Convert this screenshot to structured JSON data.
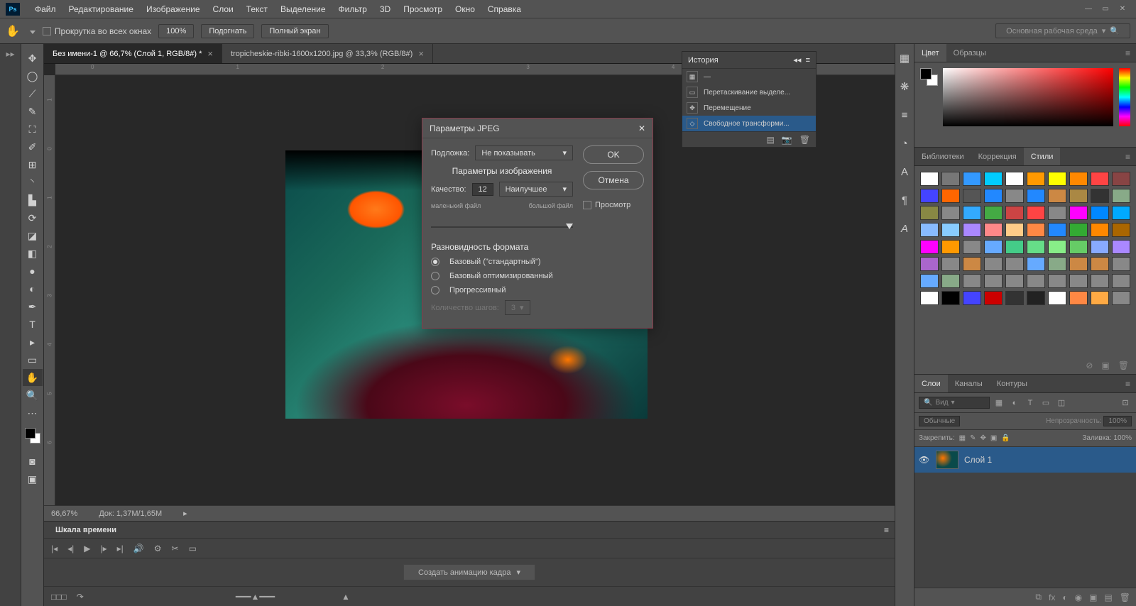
{
  "menu": {
    "items": [
      "Файл",
      "Редактирование",
      "Изображение",
      "Слои",
      "Текст",
      "Выделение",
      "Фильтр",
      "3D",
      "Просмотр",
      "Окно",
      "Справка"
    ]
  },
  "optbar": {
    "scroll_all": "Прокрутка во всех окнах",
    "zoom": "100%",
    "fit": "Подогнать",
    "full": "Полный экран",
    "workspace": "Основная рабочая среда"
  },
  "docs": {
    "tab1": "Без имени-1 @ 66,7% (Слой 1, RGB/8#) *",
    "tab2": "tropicheskie-ribki-1600x1200.jpg @ 33,3% (RGB/8#)"
  },
  "status": {
    "zoom": "66,67%",
    "doc": "Док: 1,37M/1,65M"
  },
  "timeline": {
    "title": "Шкала времени",
    "create": "Создать анимацию кадра"
  },
  "history": {
    "title": "История",
    "items": [
      "Перетаскивание выделе...",
      "Перемещение",
      "Свободное трансформи..."
    ]
  },
  "color_tabs": {
    "c1": "Цвет",
    "c2": "Образцы"
  },
  "lib_tabs": {
    "l1": "Библиотеки",
    "l2": "Коррекция",
    "l3": "Стили"
  },
  "layer_tabs": {
    "t1": "Слои",
    "t2": "Каналы",
    "t3": "Контуры"
  },
  "layers": {
    "kind": "Вид",
    "blend": "Обычные",
    "opacity_lbl": "Непрозрачность:",
    "opacity_val": "100%",
    "lock_lbl": "Закрепить:",
    "fill_lbl": "Заливка:",
    "fill_val": "100%",
    "layer1": "Слой 1"
  },
  "dialog": {
    "title": "Параметры JPEG",
    "matte_lbl": "Подложка:",
    "matte_val": "Не показывать",
    "ok": "OK",
    "cancel": "Отмена",
    "preview": "Просмотр",
    "img_sec": "Параметры изображения",
    "quality_lbl": "Качество:",
    "quality_val": "12",
    "quality_preset": "Наилучшее",
    "small": "маленький файл",
    "large": "большой файл",
    "fmt_sec": "Разновидность формата",
    "fmt1": "Базовый (\"стандартный\")",
    "fmt2": "Базовый оптимизированный",
    "fmt3": "Прогрессивный",
    "scans_lbl": "Количество шагов:",
    "scans_val": "3"
  },
  "style_colors": [
    "#fff",
    "#777",
    "#39f",
    "#0cf",
    "#fff",
    "#f90",
    "#ff0",
    "#f80",
    "#f44",
    "#844",
    "#44f",
    "#f60",
    "#555",
    "#28f",
    "#888",
    "#28f",
    "#c84",
    "#a84",
    "#333",
    "#8a8",
    "#884",
    "#888",
    "#3af",
    "#4a4",
    "#c44",
    "#f44",
    "#888",
    "#f0f",
    "#08f",
    "#0af",
    "#8bf",
    "#8cf",
    "#a8f",
    "#f88",
    "#fc8",
    "#f84",
    "#28f",
    "#3a3",
    "#f80",
    "#a60",
    "#f0f",
    "#f90",
    "#888",
    "#6af",
    "#4c8",
    "#6d8",
    "#8e8",
    "#6c6",
    "#8af",
    "#a8f",
    "#a6c",
    "#888",
    "#c84",
    "#888",
    "#888",
    "#6af",
    "#8a8",
    "#c84",
    "#c84",
    "#888",
    "#6af",
    "#8a8",
    "#888",
    "#888",
    "#888",
    "#888",
    "#888",
    "#888",
    "#888",
    "#888",
    "#fff",
    "#000",
    "#44f",
    "#c00",
    "#333",
    "#222",
    "#fff",
    "#f84",
    "#fa4",
    "#888"
  ]
}
